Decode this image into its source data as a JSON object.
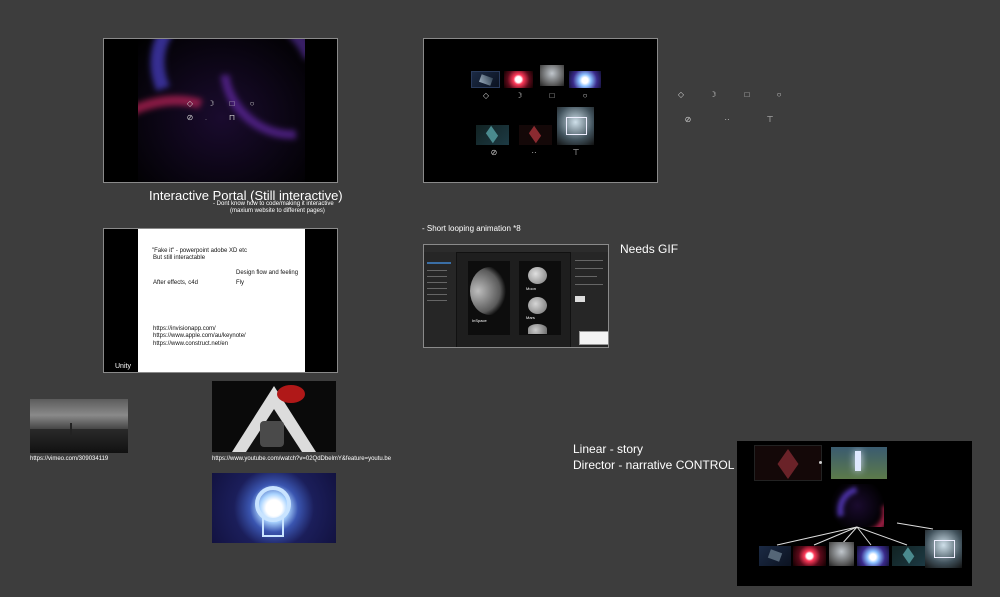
{
  "portal": {
    "caption": "Interactive Portal (Still interactive)",
    "note1": "- Dont know how to code/making it interactive",
    "note2": "(maxium website to different pages)"
  },
  "slide": {
    "fake_it": "\"Fake it\" - powerpoint adobe XD etc",
    "still": "But still interactable",
    "design": "Design flow and feeling",
    "fly": "Fly",
    "after": "After effects, c4d",
    "link1": "https://invisionapp.com/",
    "link2": "https://www.apple.com/au/keynote/",
    "link3": "https://www.construct.net/en",
    "unity": "Unity"
  },
  "notes": {
    "looping": "- Short looping animation *8",
    "gif": "Needs GIF",
    "linear": "Linear - story",
    "director": "Director - narrative CONTROL"
  },
  "xd": {
    "card1_title": "InSpace",
    "moon_label": "Moon",
    "mars_label": "Mars"
  },
  "refs": {
    "vimeo": "https://vimeo.com/309034119",
    "youtube": "https://www.youtube.com/watch?v=02QdDbelmY&feature=youtu.be"
  },
  "icons": [
    "diamond-icon",
    "crescent-icon",
    "square-icon",
    "circle-icon",
    "pill-icon",
    "dash-icon",
    "arch-icon"
  ],
  "colors": {
    "background": "#3d3d3d",
    "accent_magenta": "#c2185b",
    "accent_purple": "#5b2a9e",
    "glow_blue": "#7fb7ff"
  }
}
